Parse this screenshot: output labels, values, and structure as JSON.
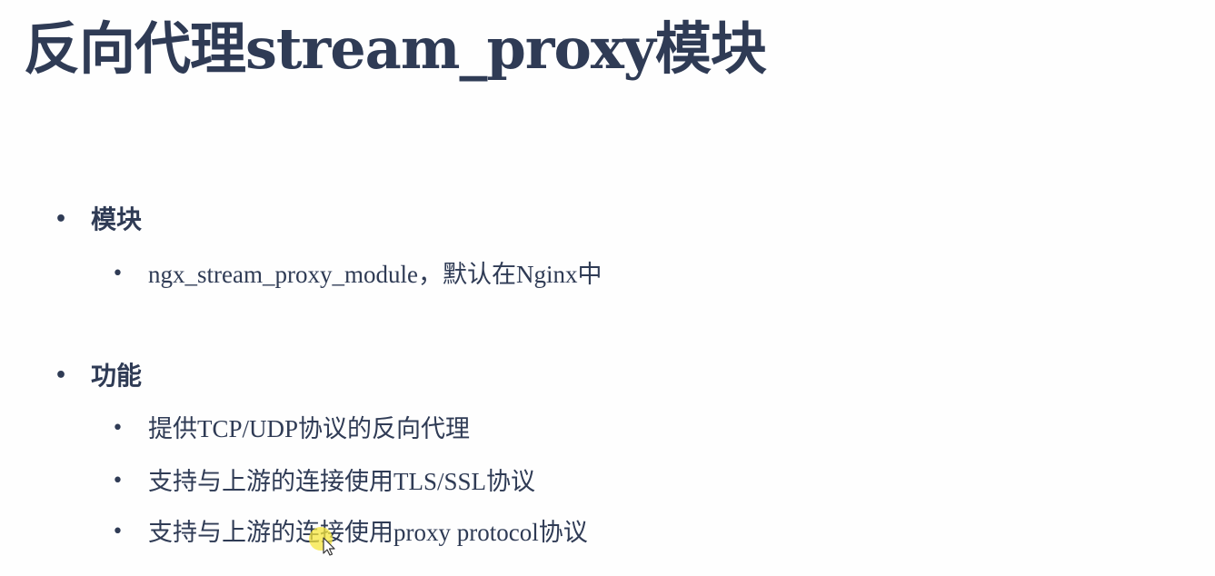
{
  "slide": {
    "title_cn1": "反向代理",
    "title_en": "stream_proxy",
    "title_cn2": "模块",
    "sections": [
      {
        "heading": "模块",
        "items": [
          {
            "en": "ngx_stream_proxy_module",
            "cn": "，默认在",
            "en2": "Nginx",
            "cn2": "中"
          }
        ]
      },
      {
        "heading": "功能",
        "items": [
          {
            "cn": "提供",
            "en": "TCP/UDP",
            "cn2": "协议的反向代理"
          },
          {
            "cn": "支持与上游的连接使用",
            "en": "TLS/SSL",
            "cn2": "协议"
          },
          {
            "cn": "支持与上游的连接使用",
            "en": "proxy protocol",
            "cn2": "协议"
          }
        ]
      }
    ],
    "bullet_symbol": "•"
  },
  "colors": {
    "text": "#2f3b55",
    "cursor_highlight": "#f5e63c"
  },
  "icons": {
    "cursor": "mouse-pointer-icon"
  }
}
